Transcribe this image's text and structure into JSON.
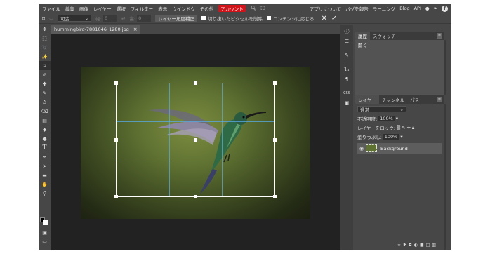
{
  "menu": {
    "items": [
      "ファイル",
      "編集",
      "画像",
      "レイヤー",
      "選択",
      "フィルター",
      "表示",
      "ウインドウ",
      "その他"
    ],
    "account": "アカウント",
    "search_icon": "search-icon",
    "fullscreen_icon": "fullscreen-icon",
    "right_items": [
      "アプリについて",
      "バグを報告",
      "ラーニング",
      "Blog",
      "API"
    ],
    "social_icons": [
      "reddit-icon",
      "twitter-icon",
      "facebook-icon"
    ]
  },
  "options": {
    "mode_value": "可変",
    "w_label": "幅:",
    "w_value": "0",
    "h_label": "高:",
    "h_value": "0",
    "straighten_label": "レイヤー角度補正",
    "delete_cropped_label": "切り抜いたピクセルを削除",
    "content_aware_label": "コンテンツに応じる"
  },
  "document": {
    "tab_title": "hummingbird-7881046_1280.jpg",
    "close_glyph": "×"
  },
  "history_panel": {
    "tabs": [
      "履歴",
      "スウォッチ"
    ],
    "item": "開く"
  },
  "layers_panel": {
    "tabs": [
      "レイヤー",
      "チャンネル",
      "パス"
    ],
    "blend_mode": "通常",
    "opacity_label": "不透明度:",
    "opacity_value": "100%",
    "lock_label": "レイヤーをロック:",
    "fill_label": "塗りつぶし:",
    "fill_value": "100%",
    "layer_name": "Background"
  },
  "colors": {
    "accent": "#d4121a",
    "ui_bg": "#474747",
    "canvas_bg": "#222222",
    "crop_guides": "#5aaae6"
  }
}
